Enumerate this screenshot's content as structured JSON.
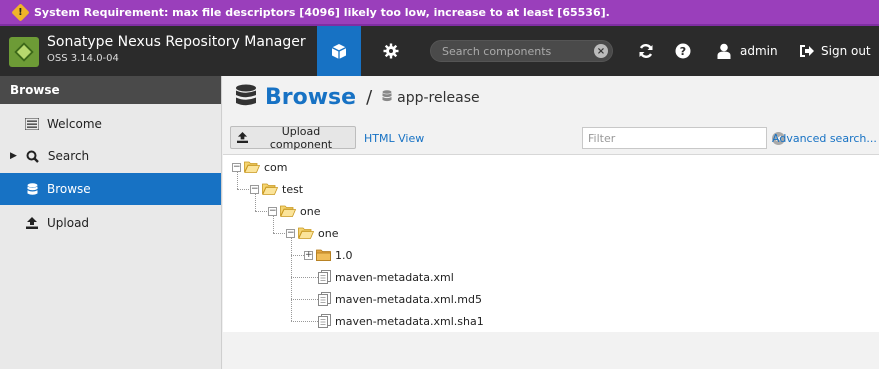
{
  "banner": {
    "icon": "warning-icon",
    "text": "System Requirement: max file descriptors [4096] likely too low, increase to at least [65536]."
  },
  "header": {
    "app_name": "Sonatype Nexus Repository Manager",
    "version": "OSS 3.14.0-04",
    "search_placeholder": "Search components",
    "user_label": "admin",
    "signout_label": "Sign out"
  },
  "sidebar": {
    "header": "Browse",
    "items": [
      {
        "label": "Welcome",
        "icon": "list-icon",
        "active": false
      },
      {
        "label": "Search",
        "icon": "search-icon",
        "active": false,
        "expandable": true
      },
      {
        "label": "Browse",
        "icon": "database-icon",
        "active": true
      },
      {
        "label": "Upload",
        "icon": "upload-icon",
        "active": false
      }
    ]
  },
  "main": {
    "title": "Browse",
    "separator": "/",
    "repository": "app-release",
    "upload_button": "Upload component",
    "html_view_link": "HTML View",
    "filter_placeholder": "Filter",
    "advanced_search_link": "Advanced search...",
    "tree": [
      {
        "label": "com",
        "type": "folder-open",
        "expanded": true
      },
      {
        "label": "test",
        "type": "folder-open",
        "expanded": true
      },
      {
        "label": "one",
        "type": "folder-open",
        "expanded": true
      },
      {
        "label": "one",
        "type": "folder-open",
        "expanded": true
      },
      {
        "label": "1.0",
        "type": "folder-closed",
        "expanded": false
      },
      {
        "label": "maven-metadata.xml",
        "type": "file"
      },
      {
        "label": "maven-metadata.xml.md5",
        "type": "file"
      },
      {
        "label": "maven-metadata.xml.sha1",
        "type": "file"
      }
    ]
  },
  "colors": {
    "banner": "#9a3fbb",
    "header": "#2b2b2b",
    "accent": "#1772c4"
  }
}
